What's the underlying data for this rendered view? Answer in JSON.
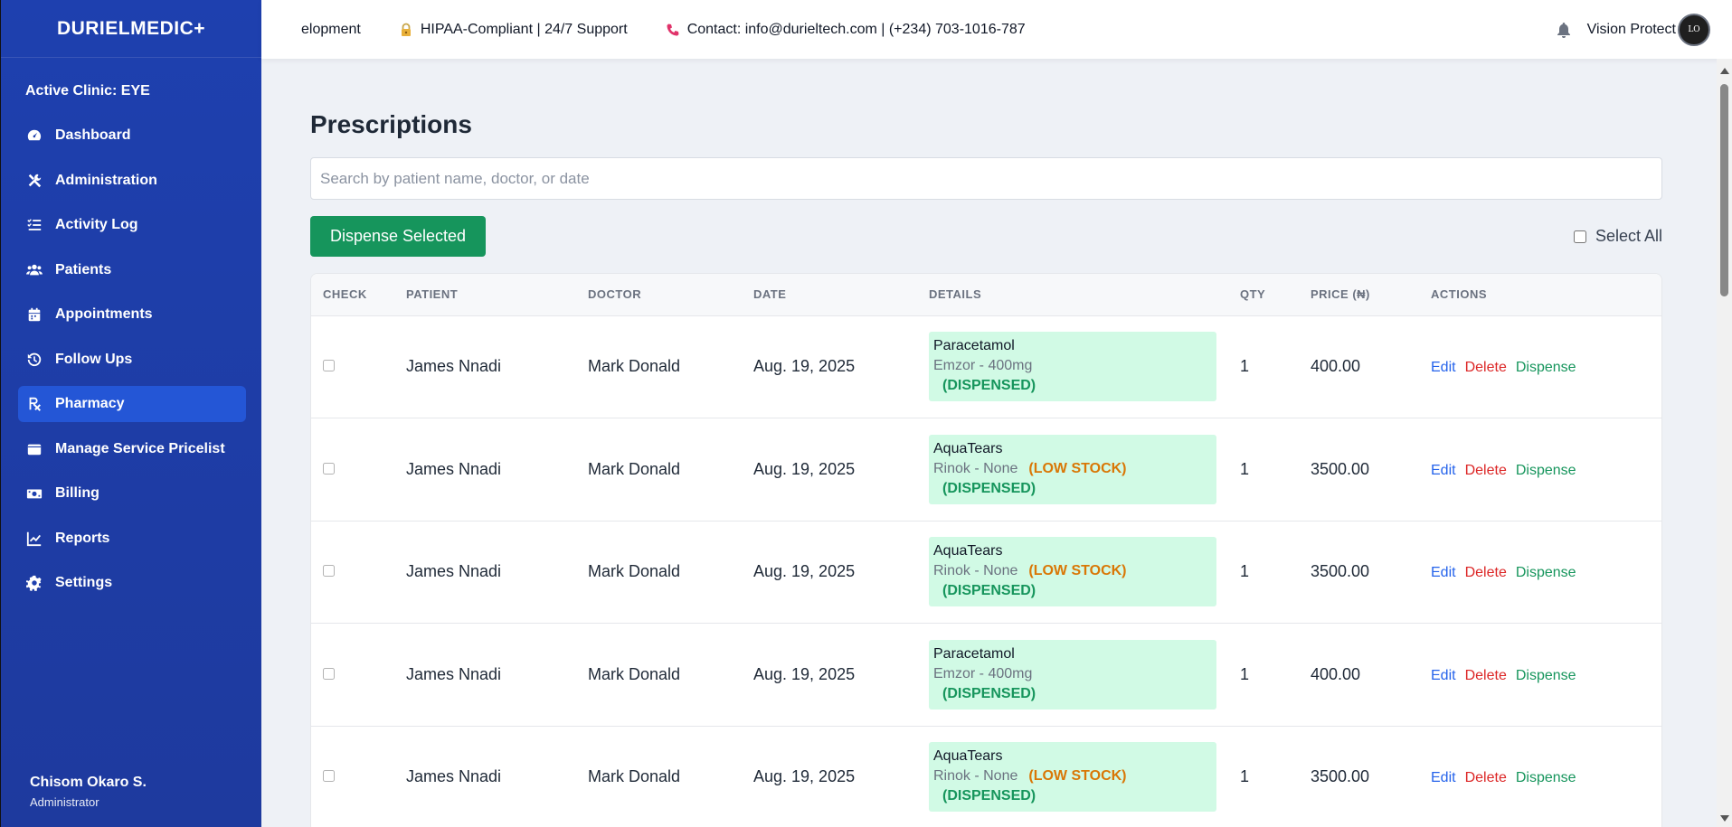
{
  "sidebar": {
    "brand": "DURIELMEDIC+",
    "clinic": "Active Clinic: EYE",
    "items": [
      {
        "label": "Dashboard",
        "icon": "gauge-icon"
      },
      {
        "label": "Administration",
        "icon": "tools-icon"
      },
      {
        "label": "Activity Log",
        "icon": "list-check-icon"
      },
      {
        "label": "Patients",
        "icon": "users-icon"
      },
      {
        "label": "Appointments",
        "icon": "calendar-icon"
      },
      {
        "label": "Follow Ups",
        "icon": "history-icon"
      },
      {
        "label": "Pharmacy",
        "icon": "prescription-icon",
        "active": true
      },
      {
        "label": "Manage Service Pricelist",
        "icon": "wallet-icon"
      },
      {
        "label": "Billing",
        "icon": "money-bill-icon"
      },
      {
        "label": "Reports",
        "icon": "chart-line-icon"
      },
      {
        "label": "Settings",
        "icon": "gear-icon"
      }
    ],
    "user": {
      "name": "Chisom Okaro S.",
      "role": "Administrator"
    }
  },
  "topbar": {
    "ticker": [
      "elopment",
      "HIPAA-Compliant | 24/7 Support",
      "Contact: info@durieltech.com | (+234) 703-1016-787"
    ],
    "org": "Vision Protect",
    "avatar_text": "LO"
  },
  "main": {
    "title": "Prescriptions",
    "search_placeholder": "Search by patient name, doctor, or date",
    "dispense_button": "Dispense Selected",
    "select_all": "Select All",
    "columns": [
      "CHECK",
      "PATIENT",
      "DOCTOR",
      "DATE",
      "DETAILS",
      "QTY",
      "PRICE (₦)",
      "ACTIONS"
    ],
    "rows": [
      {
        "patient": "James Nnadi",
        "doctor": "Mark Donald",
        "date": "Aug. 19, 2025",
        "drug": "Paracetamol",
        "sub": "Emzor - 400mg",
        "low": "",
        "status": "(DISPENSED)",
        "qty": "1",
        "price": "400.00"
      },
      {
        "patient": "James Nnadi",
        "doctor": "Mark Donald",
        "date": "Aug. 19, 2025",
        "drug": "AquaTears",
        "sub": "Rinok - None",
        "low": "(LOW STOCK)",
        "status": "(DISPENSED)",
        "qty": "1",
        "price": "3500.00"
      },
      {
        "patient": "James Nnadi",
        "doctor": "Mark Donald",
        "date": "Aug. 19, 2025",
        "drug": "AquaTears",
        "sub": "Rinok - None",
        "low": "(LOW STOCK)",
        "status": "(DISPENSED)",
        "qty": "1",
        "price": "3500.00"
      },
      {
        "patient": "James Nnadi",
        "doctor": "Mark Donald",
        "date": "Aug. 19, 2025",
        "drug": "Paracetamol",
        "sub": "Emzor - 400mg",
        "low": "",
        "status": "(DISPENSED)",
        "qty": "1",
        "price": "400.00"
      },
      {
        "patient": "James Nnadi",
        "doctor": "Mark Donald",
        "date": "Aug. 19, 2025",
        "drug": "AquaTears",
        "sub": "Rinok - None",
        "low": "(LOW STOCK)",
        "status": "(DISPENSED)",
        "qty": "1",
        "price": "3500.00"
      }
    ],
    "actions": {
      "edit": "Edit",
      "delete": "Delete",
      "dispense": "Dispense"
    }
  },
  "colors": {
    "sidebar": "#1e40af",
    "active": "#2456d6",
    "primary_green": "#16955c",
    "details_bg": "#d1fae5",
    "low_stock": "#d97706",
    "edit": "#2563eb",
    "delete": "#dc2626"
  }
}
